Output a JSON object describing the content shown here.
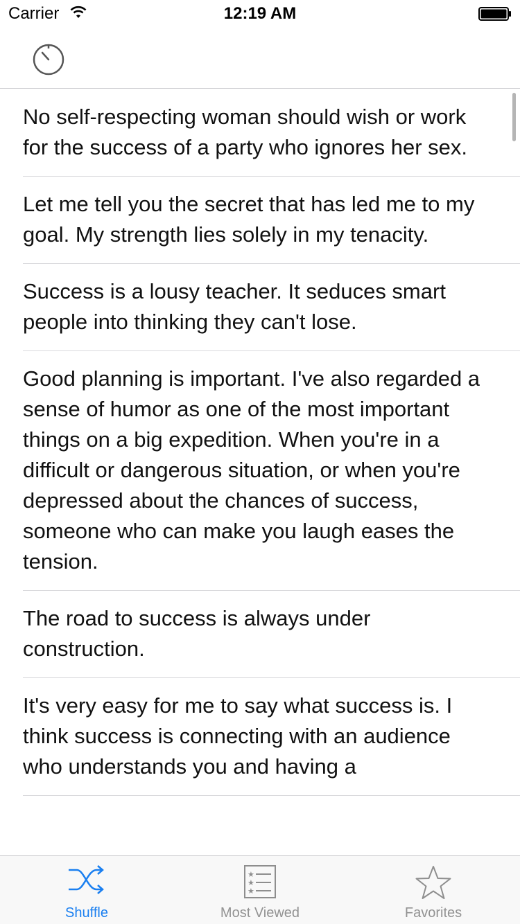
{
  "status_bar": {
    "carrier": "Carrier",
    "time": "12:19 AM"
  },
  "nav_bar": {
    "left_icon": "timer-icon"
  },
  "quotes": [
    "No self-respecting woman should wish or work for the success of a party who ignores her sex.",
    "Let me tell you the secret that has led me to my goal. My strength lies solely in my tenacity.",
    "Success is a lousy teacher. It seduces smart people into thinking they can't lose.",
    "Good planning is important. I've also regarded a sense of humor as one of the most important things on a big expedition. When you're in a difficult or dangerous situation, or when you're depressed about the chances of success, someone who can make you laugh eases the tension.",
    "The road to success is always under construction.",
    "It's very easy for me to say what success is. I think success is connecting with an audience who understands you and having a"
  ],
  "tab_bar": {
    "tabs": [
      {
        "label": "Shuffle",
        "icon": "shuffle-icon",
        "active": true
      },
      {
        "label": "Most Viewed",
        "icon": "list-icon",
        "active": false
      },
      {
        "label": "Favorites",
        "icon": "star-icon",
        "active": false
      }
    ]
  },
  "colors": {
    "accent": "#1a7ff0",
    "inactive": "#929292",
    "separator": "#d9d9dc"
  }
}
